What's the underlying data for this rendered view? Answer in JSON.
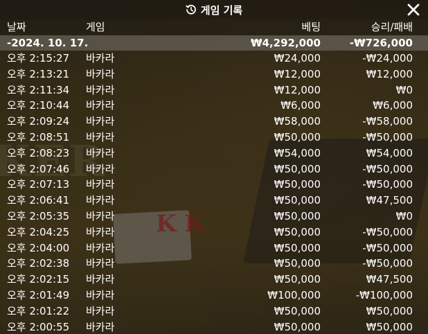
{
  "window": {
    "title": "게임 기록",
    "title_icon": "history-icon",
    "close_icon": "close-icon"
  },
  "columns": {
    "date": "날짜",
    "game": "게임",
    "bet": "베팅",
    "win_loss": "승리/패배"
  },
  "summary": {
    "date": "-2024. 10. 17.",
    "bet": "₩4,292,000",
    "win_loss": "-₩726,000"
  },
  "rows": [
    {
      "time": "오후 2:15:27",
      "game": "바카라",
      "bet": "₩24,000",
      "win_loss": "-₩24,000"
    },
    {
      "time": "오후 2:13:21",
      "game": "바카라",
      "bet": "₩12,000",
      "win_loss": "₩12,000"
    },
    {
      "time": "오후 2:11:34",
      "game": "바카라",
      "bet": "₩12,000",
      "win_loss": "₩0"
    },
    {
      "time": "오후 2:10:44",
      "game": "바카라",
      "bet": "₩6,000",
      "win_loss": "₩6,000"
    },
    {
      "time": "오후 2:09:24",
      "game": "바카라",
      "bet": "₩58,000",
      "win_loss": "-₩58,000"
    },
    {
      "time": "오후 2:08:51",
      "game": "바카라",
      "bet": "₩50,000",
      "win_loss": "-₩50,000"
    },
    {
      "time": "오후 2:08:23",
      "game": "바카라",
      "bet": "₩54,000",
      "win_loss": "₩54,000"
    },
    {
      "time": "오후 2:07:46",
      "game": "바카라",
      "bet": "₩50,000",
      "win_loss": "-₩50,000"
    },
    {
      "time": "오후 2:07:13",
      "game": "바카라",
      "bet": "₩50,000",
      "win_loss": "-₩50,000"
    },
    {
      "time": "오후 2:06:41",
      "game": "바카라",
      "bet": "₩50,000",
      "win_loss": "₩47,500"
    },
    {
      "time": "오후 2:05:35",
      "game": "바카라",
      "bet": "₩50,000",
      "win_loss": "₩0"
    },
    {
      "time": "오후 2:04:25",
      "game": "바카라",
      "bet": "₩50,000",
      "win_loss": "-₩50,000"
    },
    {
      "time": "오후 2:04:00",
      "game": "바카라",
      "bet": "₩50,000",
      "win_loss": "-₩50,000"
    },
    {
      "time": "오후 2:02:38",
      "game": "바카라",
      "bet": "₩50,000",
      "win_loss": "-₩50,000"
    },
    {
      "time": "오후 2:02:15",
      "game": "바카라",
      "bet": "₩50,000",
      "win_loss": "₩47,500"
    },
    {
      "time": "오후 2:01:49",
      "game": "바카라",
      "bet": "₩100,000",
      "win_loss": "-₩100,000"
    },
    {
      "time": "오후 2:01:22",
      "game": "바카라",
      "bet": "₩50,000",
      "win_loss": "₩50,000"
    },
    {
      "time": "오후 2:00:55",
      "game": "바카라",
      "bet": "₩50,000",
      "win_loss": "₩50,000"
    }
  ]
}
